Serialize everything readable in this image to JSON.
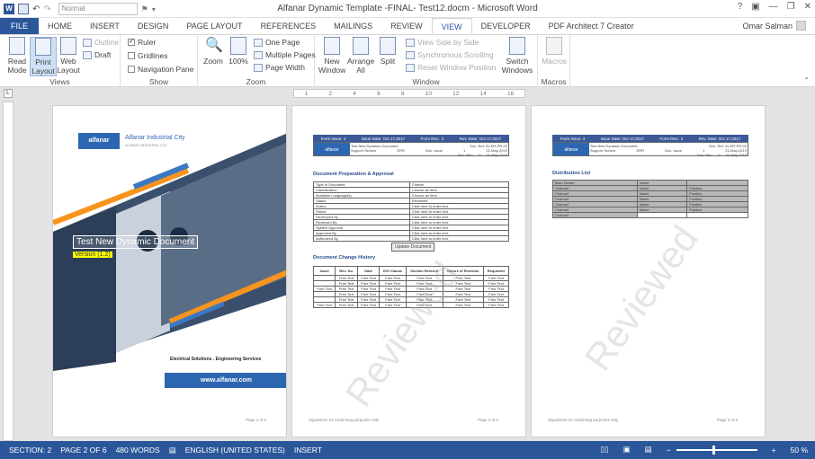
{
  "titlebar": {
    "style_box": "Normal",
    "title": "Alfanar Dynamic Template -FINAL- Test12.docm - Microsoft Word"
  },
  "tabs": [
    "FILE",
    "HOME",
    "INSERT",
    "DESIGN",
    "PAGE LAYOUT",
    "REFERENCES",
    "MAILINGS",
    "REVIEW",
    "VIEW",
    "DEVELOPER",
    "PDF Architect 7 Creator"
  ],
  "user": "Omar Salman",
  "ribbon": {
    "views": {
      "label": "Views",
      "read": "Read Mode",
      "print": "Print Layout",
      "web": "Web Layout",
      "outline": "Outline",
      "draft": "Draft"
    },
    "show": {
      "label": "Show",
      "ruler": "Ruler",
      "gridlines": "Gridlines",
      "nav": "Navigation Pane"
    },
    "zoom": {
      "label": "Zoom",
      "zoom": "Zoom",
      "hundred": "100%",
      "one": "One Page",
      "multi": "Multiple Pages",
      "width": "Page Width"
    },
    "window": {
      "label": "Window",
      "new": "New Window",
      "arrange": "Arrange All",
      "split": "Split",
      "side": "View Side by Side",
      "sync": "Synchronous Scrolling",
      "reset": "Reset Window Position",
      "switch": "Switch Windows"
    },
    "macros": {
      "label": "Macros",
      "btn": "Macros"
    }
  },
  "ruler_ticks": [
    "1",
    "1",
    "2",
    "3",
    "4",
    "5",
    "6",
    "7",
    "8",
    "9",
    "10",
    "11",
    "12",
    "13",
    "14",
    "15",
    "16"
  ],
  "page1": {
    "brand": "Alfanar Industrial City",
    "brand_sub": "ALFANAR INDUSTRIAL CITY",
    "title": "Test New Dynamic Document",
    "version": "Version (1.2)",
    "services": "Electrical Solutions . Engineering Services",
    "url": "www.alfanar.com",
    "page": "Page 1 of 6"
  },
  "page2": {
    "h1": "Form Issue: 4",
    "h2": "Issue Date: Oct 17,2017",
    "h3": "Form Rev.: 3",
    "h4": "Rev. Date: Oct 17,2017",
    "docname": "Test New Dynamic Document",
    "docref": "Doc. Ref: 20-ER-PR-02",
    "dept": "Support Service",
    "code": "ERR",
    "issue_lbl": "Doc. Issue",
    "issue_val": "1",
    "issue_date": "21-May-2019",
    "rev_lbl": "Doc. Rev.",
    "rev_val": "0",
    "rev_date": "01-May-2019",
    "sec1": "Document Preparation & Approval",
    "rows": [
      "Type of Document",
      "Classification",
      "Available Language(s)",
      "Status",
      "Author",
      "Owner",
      "Developed By",
      "Reviewed By",
      "System Approval",
      "Approved By",
      "Authorized By"
    ],
    "vals": [
      "Charter",
      "Choose an item.",
      "Choose an item.",
      "Reviewed",
      "Click here to enter text.",
      "Click here to enter text.",
      "Click here to enter text.",
      "Click here to enter text.",
      "Click here to enter text.",
      "Click here to enter text.",
      "Click here to enter text."
    ],
    "update": "Update Document",
    "sec2": "Document Change History",
    "ch": [
      "Issue",
      "Rev. No.",
      "Date",
      "ISO Clause",
      "Section Revised",
      "Nature of Revision",
      "Requester"
    ],
    "ft": "Free Text",
    "footnote": "Signatures for endorsing purposes only",
    "page": "Page 2 of 6",
    "wm": "Reviewed"
  },
  "page3": {
    "sec": "Distribution List",
    "dl": [
      [
        "Main Owner",
        "Name",
        ""
      ],
      [
        "Channel",
        "Name",
        "Position"
      ],
      [
        "Channel",
        "Name",
        "Position"
      ],
      [
        "Channel",
        "Name",
        "Position"
      ],
      [
        "Channel",
        "Name",
        "Position"
      ],
      [
        "Channel",
        "Name",
        "Position"
      ],
      [
        "Channel",
        "",
        ""
      ]
    ],
    "page": "Page 3 of 6",
    "wm": "Reviewed"
  },
  "status": {
    "section": "SECTION: 2",
    "page": "PAGE 2 OF 6",
    "words": "480 WORDS",
    "lang": "ENGLISH (UNITED STATES)",
    "mode": "INSERT",
    "zoom": "50 %"
  }
}
